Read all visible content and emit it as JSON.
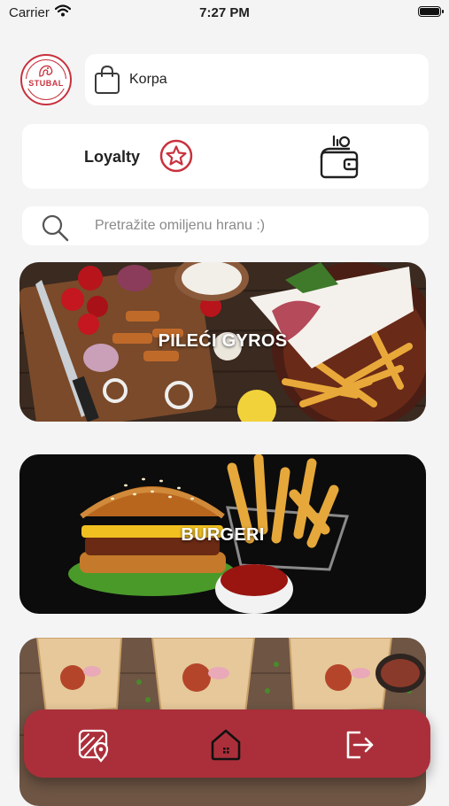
{
  "status_bar": {
    "carrier": "Carrier",
    "time": "7:27 PM"
  },
  "logo": {
    "text": "STUBAL"
  },
  "cart": {
    "label": "Korpa",
    "icon": "shopping-bag-icon"
  },
  "loyalty": {
    "label": "Loyalty",
    "icon": "star-circle-icon",
    "wallet_icon": "wallet-icon"
  },
  "search": {
    "placeholder": "Pretražite omiljenu hranu :)"
  },
  "categories": [
    {
      "title": "PILEĆI GYROS"
    },
    {
      "title": "BURGERI"
    },
    {
      "title": ""
    }
  ],
  "bottom_nav": {
    "items": [
      {
        "icon": "map-pin-icon"
      },
      {
        "icon": "home-icon"
      },
      {
        "icon": "logout-icon"
      }
    ]
  },
  "colors": {
    "accent": "#ab2f3a",
    "logo_red": "#c8313d",
    "background": "#f4f4f5"
  }
}
